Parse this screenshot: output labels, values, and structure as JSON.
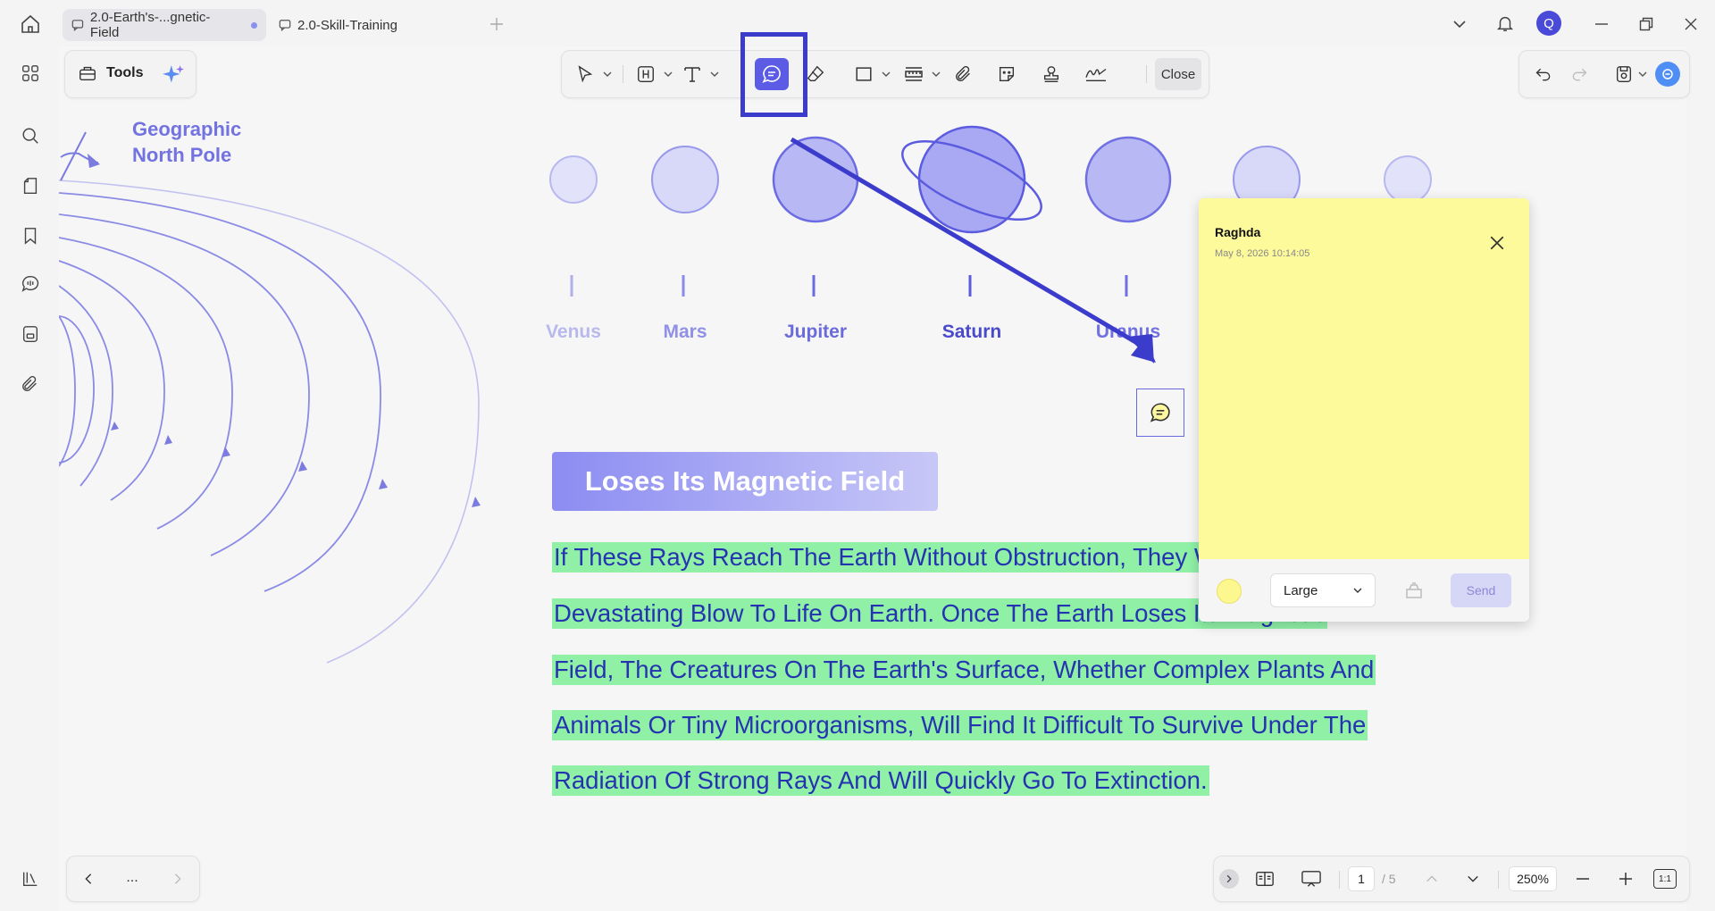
{
  "tabs": [
    {
      "label": "2.0-Earth's-...gnetic-Field",
      "active": true
    },
    {
      "label": "2.0-Skill-Training",
      "active": false
    }
  ],
  "user_avatar_letter": "Q",
  "tools_label": "Tools",
  "toolbar": {
    "close_label": "Close"
  },
  "page": {
    "pole_label_line1": "Geographic",
    "pole_label_line2": "North Pole",
    "planets": [
      "Venus",
      "Mars",
      "Jupiter",
      "Saturn",
      "Uranus"
    ],
    "title": "Loses Its Magnetic Field",
    "body_lines": [
      "If These Rays Reach The Earth Without Obstruction, They Will Deal A",
      "Devastating Blow To Life On Earth. Once The Earth Loses Its Magnetic",
      "Field, The Creatures On The Earth's Surface, Whether Complex Plants And",
      "Animals Or Tiny Microorganisms, Will Find It Difficult To Survive Under The",
      "Radiation Of Strong Rays And Will Quickly Go To Extinction."
    ]
  },
  "note": {
    "author": "Raghda",
    "timestamp": "May 8, 2026 10:14:05",
    "color": "#fdfa9c",
    "font_size_option": "Large",
    "send_label": "Send"
  },
  "footer": {
    "more_label": "...",
    "current_page": "1",
    "total_pages": "/ 5",
    "zoom": "250%",
    "actual_size_label": "1:1"
  },
  "colors": {
    "accent": "#5b5be6",
    "annotation_box": "#3c3ccc",
    "highlight": "#8ff0a6",
    "planet": "#a9a9f3"
  }
}
